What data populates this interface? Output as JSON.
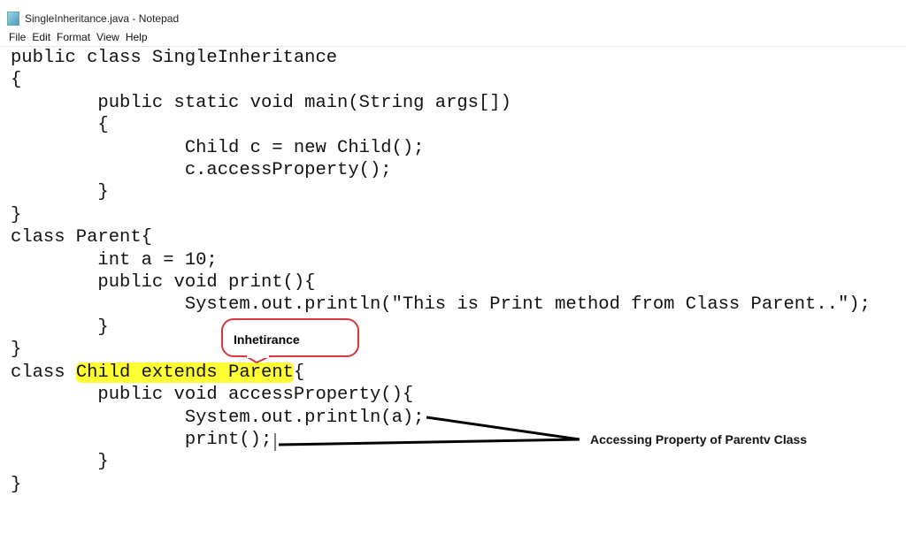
{
  "window": {
    "title": "SingleInheritance.java - Notepad",
    "icon": "notepad-icon"
  },
  "menu": [
    "File",
    "Edit",
    "Format",
    "View",
    "Help"
  ],
  "code": {
    "lines": [
      "public class SingleInheritance",
      "{",
      "        public static void main(String args[])",
      "        {",
      "                Child c = new Child();",
      "                c.accessProperty();",
      "        }",
      "}",
      "class Parent{",
      "        int a = 10;",
      "        public void print(){",
      "                System.out.println(\"This is Print method from Class Parent..\");",
      "        }",
      "}",
      "class ",
      "        public void accessProperty(){",
      "                System.out.println(a);",
      "                print();",
      "        }",
      "}"
    ],
    "highlighted": "Child extends Parent",
    "highlighted_suffix": "{"
  },
  "annotations": {
    "callout": "Inhetirance",
    "callout_color": "#d9363e",
    "highlight_color": "#ffff33",
    "note": "Accessing Property of Parentv Class"
  }
}
